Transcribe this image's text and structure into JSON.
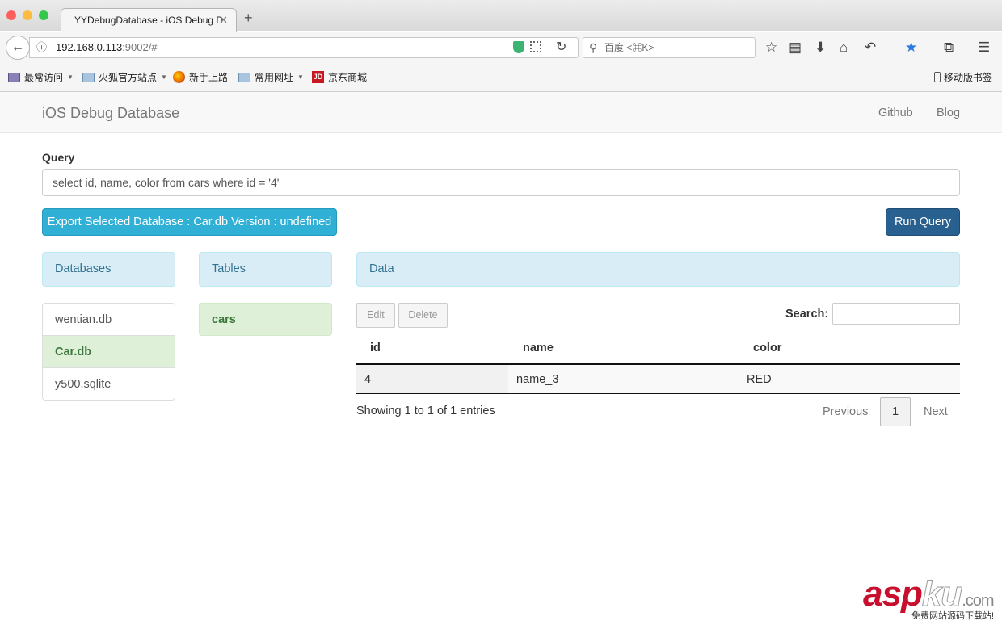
{
  "browser": {
    "tab_title": "YYDebugDatabase - iOS Debug D",
    "tab_close": "✕",
    "new_tab": "+",
    "url_host": "192.168.0.113",
    "url_path": ":9002/#",
    "search_placeholder": "百度 <⌘K>",
    "bookmarks": [
      "最常访问",
      "火狐官方站点",
      "新手上路",
      "常用网址",
      "京东商城"
    ],
    "mobile_bookmarks": "移动版书签",
    "jd_logo": "JD"
  },
  "app": {
    "brand": "iOS Debug Database",
    "nav": [
      "Github",
      "Blog"
    ]
  },
  "query": {
    "label": "Query",
    "value": "select id, name, color from cars where id = '4'"
  },
  "buttons": {
    "export": "Export Selected Database : Car.db Version : undefined",
    "run": "Run Query"
  },
  "panels": {
    "databases": "Databases",
    "tables": "Tables",
    "data": "Data"
  },
  "databases": [
    "wentian.db",
    "Car.db",
    "y500.sqlite"
  ],
  "active_database": "Car.db",
  "tables": [
    "cars"
  ],
  "data_table": {
    "edit": "Edit",
    "delete": "Delete",
    "search_label": "Search:",
    "columns": [
      "id",
      "name",
      "color"
    ],
    "rows": [
      [
        "4",
        "name_3",
        "RED"
      ]
    ],
    "info": "Showing 1 to 1 of 1 entries",
    "previous": "Previous",
    "page": "1",
    "next": "Next"
  },
  "watermark": {
    "asp": "asp",
    "ku": "ku",
    "com": ".com",
    "sub": "免费网站源码下载站!"
  }
}
